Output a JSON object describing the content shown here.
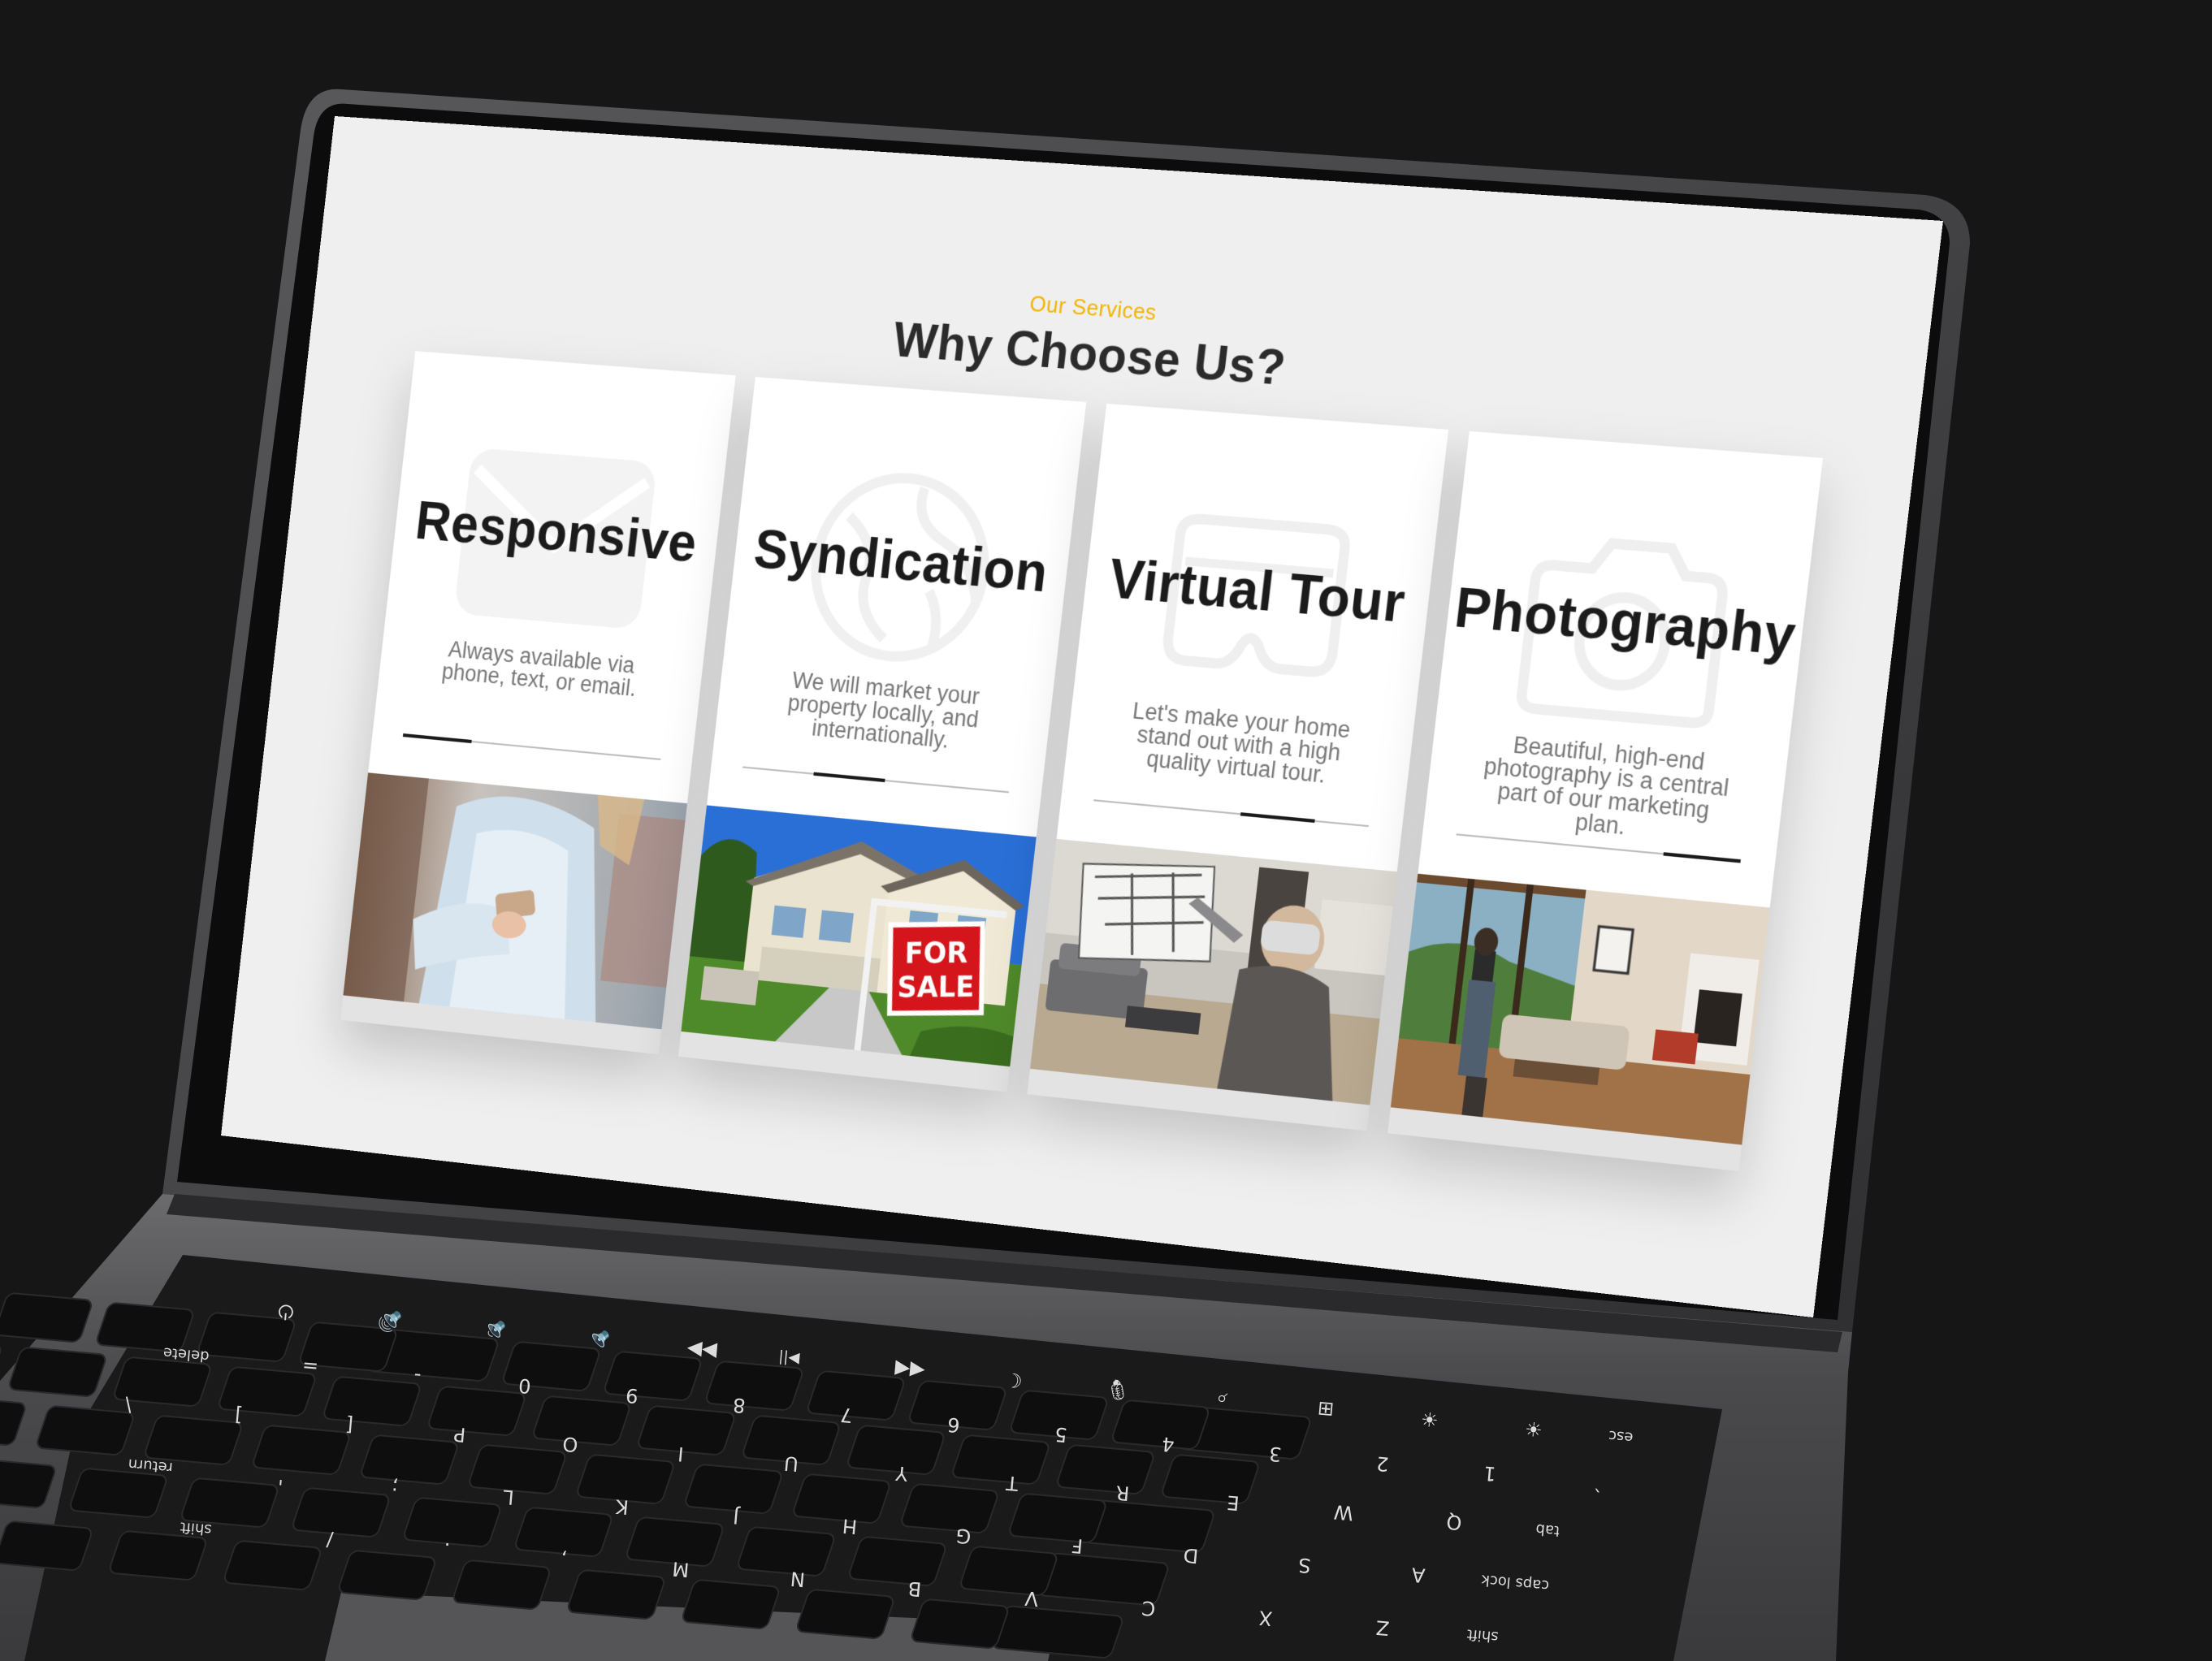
{
  "section": {
    "eyebrow": "Our Services",
    "title": "Why Choose Us?"
  },
  "cards": [
    {
      "title": "Responsive",
      "description": "Always available via phone, text, or email.",
      "icon": "mail-icon",
      "photo": "woman-holding-phone"
    },
    {
      "title": "Syndication",
      "description": "We will market your property locally, and internationally.",
      "icon": "globe-icon",
      "photo": "house-for-sale"
    },
    {
      "title": "Virtual Tour",
      "description": "Let's make your home stand out with a high quality virtual tour.",
      "icon": "vr-headset-icon",
      "photo": "woman-vr-headset-floorplan"
    },
    {
      "title": "Photography",
      "description": "Beautiful, high-end photography is a central part of our marketing plan.",
      "icon": "camera-icon",
      "photo": "photographer-living-room"
    }
  ],
  "sign": {
    "line1": "FOR",
    "line2": "SALE"
  },
  "colors": {
    "accent": "#f2b300",
    "background": "#161616",
    "screen": "#efefef",
    "sign_red": "#d4161c"
  },
  "keyboard": {
    "rows": [
      [
        "esc",
        "☀",
        "☀",
        "⊞",
        "⌕",
        "🎙",
        "☾",
        "◀◀",
        "▶||",
        "▶▶",
        "🔈",
        "🔉",
        "🔊",
        "⏻"
      ],
      [
        "`",
        "1",
        "2",
        "3",
        "4",
        "5",
        "6",
        "7",
        "8",
        "9",
        "0",
        "-",
        "=",
        "delete"
      ],
      [
        "tab",
        "Q",
        "W",
        "E",
        "R",
        "T",
        "Y",
        "U",
        "I",
        "O",
        "P",
        "[",
        "]",
        "\\"
      ],
      [
        "caps lock",
        "A",
        "S",
        "D",
        "F",
        "G",
        "H",
        "J",
        "K",
        "L",
        ";",
        "'",
        "return"
      ],
      [
        "shift",
        "Z",
        "X",
        "C",
        "V",
        "B",
        "N",
        "M",
        ",",
        ".",
        "/",
        "shift"
      ]
    ]
  }
}
